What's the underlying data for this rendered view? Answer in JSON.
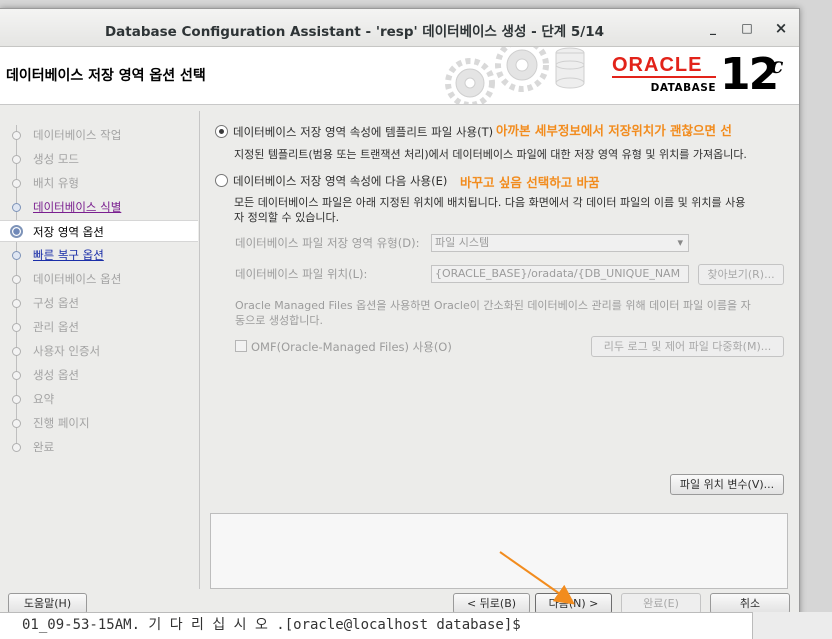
{
  "window": {
    "title": "Database Configuration Assistant - 'resp' 데이터베이스 생성 - 단계 5/14",
    "controls": {
      "minimize": "_",
      "maximize": "□",
      "close": "×"
    }
  },
  "header": {
    "title": "데이터베이스 저장 영역 옵션 선택",
    "logo_word": "ORACLE",
    "logo_sub": "DATABASE",
    "version": "12",
    "version_suffix": "c"
  },
  "steps": [
    {
      "label": "데이터베이스 작업",
      "state": "done"
    },
    {
      "label": "생성 모드",
      "state": "done"
    },
    {
      "label": "배치 유형",
      "state": "done"
    },
    {
      "label": "데이터베이스 식별",
      "state": "link-visited"
    },
    {
      "label": "저장 영역 옵션",
      "state": "current"
    },
    {
      "label": "빠른 복구 옵션",
      "state": "link"
    },
    {
      "label": "데이터베이스 옵션",
      "state": "pending"
    },
    {
      "label": "구성 옵션",
      "state": "pending"
    },
    {
      "label": "관리 옵션",
      "state": "pending"
    },
    {
      "label": "사용자 인증서",
      "state": "pending"
    },
    {
      "label": "생성 옵션",
      "state": "pending"
    },
    {
      "label": "요약",
      "state": "pending"
    },
    {
      "label": "진행 페이지",
      "state": "pending"
    },
    {
      "label": "완료",
      "state": "pending"
    }
  ],
  "options": {
    "template": {
      "label": "데이터베이스 저장 영역 속성에 템플리트 파일 사용(T)",
      "selected": true,
      "description": "지정된 템플리트(범용 또는 트랜잭션 처리)에서 데이터베이스 파일에 대한 저장 영역 유형 및 위치를 가져옵니다.",
      "annotation": "아까본 세부정보에서 저장위치가 괜찮으면 선"
    },
    "custom": {
      "label": "데이터베이스 저장 영역 속성에 다음 사용(E)",
      "selected": false,
      "annotation": "바꾸고 싶음 선택하고 바꿈",
      "description_line1": "모든 데이터베이스 파일은 아래 지정된 위치에 배치됩니다. 다음 화면에서 각 데이터 파일의 이름 및 위치를 사용",
      "description_line2": "자 정의할 수 있습니다.",
      "storage_type_label": "데이터베이스 파일 저장 영역 유형(D):",
      "storage_type_value": "파일 시스템",
      "location_label": "데이터베이스 파일 위치(L):",
      "location_value": "{ORACLE_BASE}/oradata/{DB_UNIQUE_NAM",
      "browse_label": "찾아보기(R)...",
      "omf_note_line1": "Oracle Managed Files 옵션을 사용하면 Oracle이 간소화된 데이터베이스 관리를 위해 데이터 파일 이름을 자",
      "omf_note_line2": "동으로 생성합니다.",
      "omf_checkbox_label": "OMF(Oracle-Managed Files) 사용(O)",
      "omf_checked": false,
      "multiplex_label": "리두 로그 및 제어 파일 다중화(M)..."
    }
  },
  "file_location_variables_label": "파일 위치 변수(V)...",
  "footer": {
    "help": "도움말(H)",
    "back": "< 뒤로(B)",
    "next": "다음(N) >",
    "finish": "완료(E)",
    "cancel": "취소"
  },
  "terminal": {
    "line": "01_09-53-15AM. 기 다 리 십 시 오 .[oracle@localhost database]$"
  },
  "colors": {
    "oracle_red": "#e2231a",
    "annotation_orange": "#f28c1e",
    "link_blue": "#1a2ea8",
    "link_visited": "#7a1f8f"
  }
}
